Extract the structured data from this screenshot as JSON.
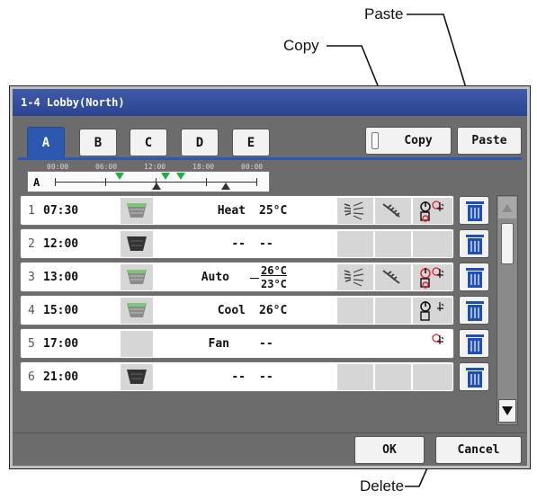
{
  "callouts": {
    "paste": "Paste",
    "copy": "Copy",
    "delete": "Delete"
  },
  "window": {
    "title": "1-4 Lobby(North)"
  },
  "tabs": [
    {
      "label": "A",
      "active": true
    },
    {
      "label": "B",
      "active": false
    },
    {
      "label": "C",
      "active": false
    },
    {
      "label": "D",
      "active": false
    },
    {
      "label": "E",
      "active": false
    }
  ],
  "toolbar": {
    "copy_label": "Copy",
    "paste_label": "Paste"
  },
  "timeline": {
    "pattern": "A",
    "hours": [
      "00:00",
      "06:00",
      "12:00",
      "18:00",
      "00:00"
    ]
  },
  "schedule": [
    {
      "num": "1",
      "time": "07:30",
      "unit": "on-icon",
      "mode": "Heat",
      "temp": "25°C"
    },
    {
      "num": "2",
      "time": "12:00",
      "unit": "off-icon",
      "mode": "--",
      "temp": "--"
    },
    {
      "num": "3",
      "time": "13:00",
      "unit": "on-icon",
      "mode": "Auto",
      "temp_hi": "26°C",
      "temp_lo": "23°C"
    },
    {
      "num": "4",
      "time": "15:00",
      "unit": "on-icon",
      "mode": "Cool",
      "temp": "26°C"
    },
    {
      "num": "5",
      "time": "17:00",
      "unit": "none",
      "mode": "Fan",
      "temp": "--"
    },
    {
      "num": "6",
      "time": "21:00",
      "unit": "off-icon",
      "mode": "--",
      "temp": "--"
    }
  ],
  "footer": {
    "ok_label": "OK",
    "cancel_label": "Cancel"
  },
  "colors": {
    "title_bar": "#2b4592",
    "active_tab": "#2c58b0",
    "trash": "#1f4fb4",
    "unit_on": "#7cc77a"
  }
}
